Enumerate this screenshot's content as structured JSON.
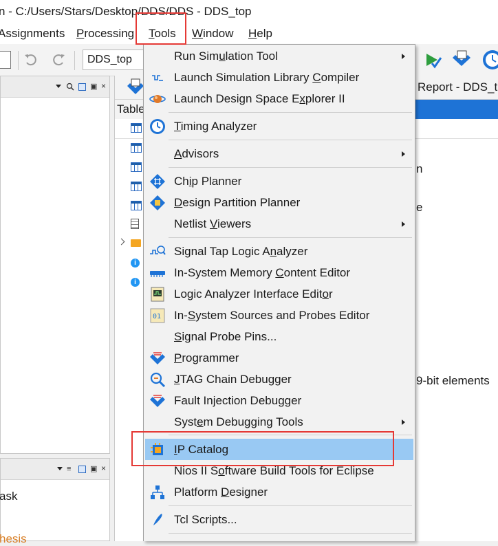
{
  "window": {
    "title": "n - C:/Users/Stars/Desktop/DDS/DDS - DDS_top"
  },
  "menubar": {
    "items": [
      {
        "label": "Assignments",
        "prefix": "",
        "ul": "",
        "rest": "Assignments"
      },
      {
        "label": "Processing",
        "prefix": "",
        "ul": "P",
        "rest": "rocessing"
      },
      {
        "label": "Tools",
        "prefix": "",
        "ul": "T",
        "rest": "ools"
      },
      {
        "label": "Window",
        "prefix": "",
        "ul": "W",
        "rest": "indow"
      },
      {
        "label": "Help",
        "prefix": "",
        "ul": "H",
        "rest": "elp"
      }
    ]
  },
  "toolbar": {
    "entity_value": "DDS_top"
  },
  "background": {
    "report_tab": "Report - DDS_t",
    "table_header": "Table",
    "right_text_1": "n",
    "right_text_2": "e",
    "right_text_3": "9-bit elements",
    "left_panel_text": "ask",
    "left_panel_text_2": "hesis"
  },
  "tools_menu": {
    "items": [
      {
        "id": "run-simulation-tool",
        "pre": "Run Sim",
        "ul": "u",
        "post": "lation Tool",
        "submenu": true,
        "icon": "none"
      },
      {
        "id": "launch-simulation-library-compiler",
        "pre": "Launch Simulation Library ",
        "ul": "C",
        "post": "ompiler",
        "submenu": false,
        "icon": "simulation-compiler-icon"
      },
      {
        "id": "launch-design-space-explorer",
        "pre": "Launch Design Space E",
        "ul": "x",
        "post": "plorer II",
        "submenu": false,
        "icon": "design-space-explorer-icon"
      },
      {
        "id": "timing-analyzer",
        "pre": "",
        "ul": "T",
        "post": "iming Analyzer",
        "submenu": false,
        "icon": "clock-icon"
      },
      {
        "id": "advisors",
        "pre": "",
        "ul": "A",
        "post": "dvisors",
        "submenu": true,
        "icon": "none"
      },
      {
        "id": "chip-planner",
        "pre": "Ch",
        "ul": "i",
        "post": "p Planner",
        "submenu": false,
        "icon": "chip-planner-icon"
      },
      {
        "id": "design-partition-planner",
        "pre": "",
        "ul": "D",
        "post": "esign Partition Planner",
        "submenu": false,
        "icon": "partition-planner-icon"
      },
      {
        "id": "netlist-viewers",
        "pre": "Netlist ",
        "ul": "V",
        "post": "iewers",
        "submenu": true,
        "icon": "none"
      },
      {
        "id": "signal-tap-logic-analyzer",
        "pre": "Signal Tap Logic A",
        "ul": "n",
        "post": "alyzer",
        "submenu": false,
        "icon": "signal-tap-icon"
      },
      {
        "id": "in-system-memory-content-editor",
        "pre": "In-System Memory ",
        "ul": "C",
        "post": "ontent Editor",
        "submenu": false,
        "icon": "memory-editor-icon"
      },
      {
        "id": "logic-analyzer-interface-editor",
        "pre": "Logic Analyzer Interface Edit",
        "ul": "o",
        "post": "r",
        "submenu": false,
        "icon": "logic-analyzer-interface-icon"
      },
      {
        "id": "in-system-sources-probes-editor",
        "pre": "In-",
        "ul": "S",
        "post": "ystem Sources and Probes Editor",
        "submenu": false,
        "icon": "sources-probes-icon"
      },
      {
        "id": "signal-probe-pins",
        "pre": "",
        "ul": "S",
        "post": "ignal Probe Pins...",
        "submenu": false,
        "icon": "none"
      },
      {
        "id": "programmer",
        "pre": "",
        "ul": "P",
        "post": "rogrammer",
        "submenu": false,
        "icon": "programmer-icon"
      },
      {
        "id": "jtag-chain-debugger",
        "pre": "",
        "ul": "J",
        "post": "TAG Chain Debugger",
        "submenu": false,
        "icon": "jtag-debugger-icon"
      },
      {
        "id": "fault-injection-debugger",
        "pre": "Fault Injection Debugger",
        "ul": "",
        "post": "",
        "submenu": false,
        "icon": "fault-injection-icon"
      },
      {
        "id": "system-debugging-tools",
        "pre": "Syst",
        "ul": "e",
        "post": "m Debugging Tools",
        "submenu": true,
        "icon": "none"
      },
      {
        "id": "ip-catalog",
        "pre": "",
        "ul": "I",
        "post": "P Catalog",
        "submenu": false,
        "icon": "ip-catalog-icon"
      },
      {
        "id": "nios-ii-software-build-tools",
        "pre": "Nios II S",
        "ul": "o",
        "post": "ftware Build Tools for Eclipse",
        "submenu": false,
        "icon": "none"
      },
      {
        "id": "platform-designer",
        "pre": "Platform ",
        "ul": "D",
        "post": "esigner",
        "submenu": false,
        "icon": "platform-designer-icon"
      },
      {
        "id": "tcl-scripts",
        "pre": "Tcl Scripts...",
        "ul": "",
        "post": "",
        "submenu": false,
        "icon": "tcl-scripts-icon"
      }
    ]
  },
  "colors": {
    "highlight": "#99c9f3",
    "annotation_red": "#e53935",
    "accent_blue": "#1e73d6"
  }
}
